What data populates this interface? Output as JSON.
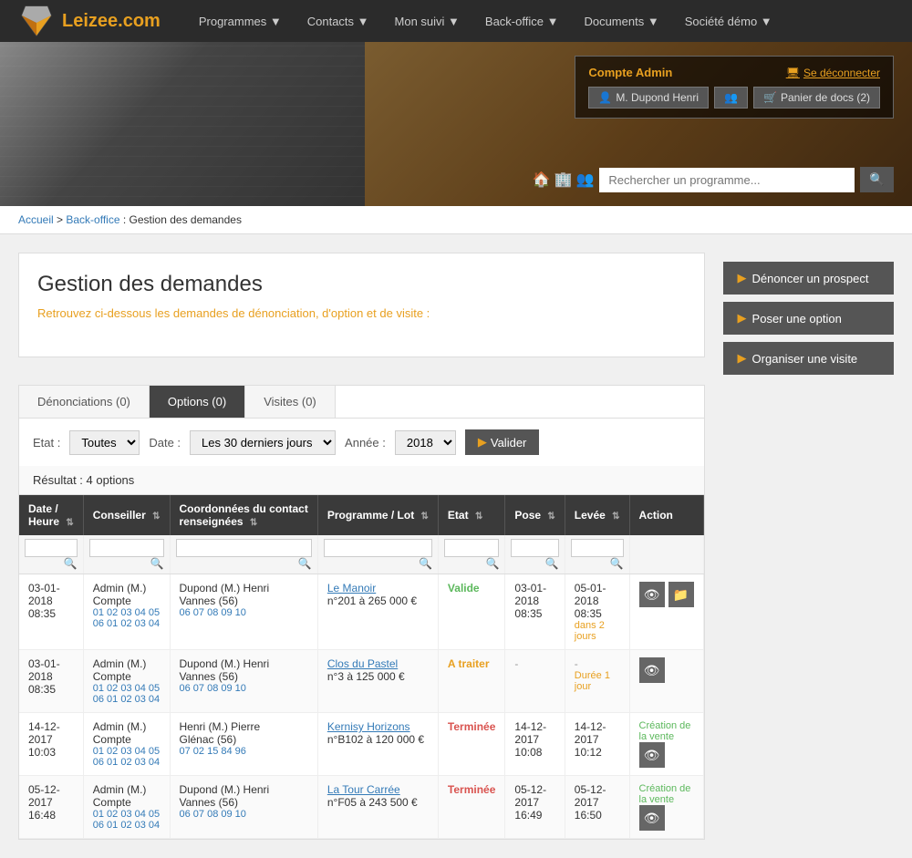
{
  "nav": {
    "logo_text": "Leizee",
    "logo_dot": ".",
    "logo_com": "com",
    "items": [
      {
        "label": "Programmes ▼"
      },
      {
        "label": "Contacts ▼"
      },
      {
        "label": "Mon suivi ▼"
      },
      {
        "label": "Back-office ▼"
      },
      {
        "label": "Documents ▼"
      },
      {
        "label": "Société démo ▼"
      }
    ]
  },
  "account": {
    "title": "Compte Admin",
    "deconnect": "Se déconnecter",
    "user_btn": "M. Dupond Henri",
    "contacts_btn": "",
    "panier_btn": "Panier de docs (2)"
  },
  "search": {
    "placeholder": "Rechercher un programme..."
  },
  "breadcrumb": {
    "home": "Accueil",
    "section": "Back-office",
    "current": "Gestion des demandes"
  },
  "page": {
    "title": "Gestion des demandes",
    "subtitle": "Retrouvez ci-dessous les demandes de dénonciation, d'option et de visite :"
  },
  "actions": {
    "denoncer": "Dénoncer un prospect",
    "option": "Poser une option",
    "visite": "Organiser une visite"
  },
  "tabs": [
    {
      "label": "Dénonciations (0)",
      "active": false
    },
    {
      "label": "Options (0)",
      "active": true
    },
    {
      "label": "Visites (0)",
      "active": false
    }
  ],
  "filters": {
    "etat_label": "Etat :",
    "etat_value": "Toutes",
    "date_label": "Date :",
    "date_value": "Les 30 derniers jours",
    "annee_label": "Année :",
    "annee_value": "2018",
    "valider_label": "Valider"
  },
  "results": {
    "text": "Résultat : 4 options"
  },
  "table": {
    "headers": [
      {
        "label": "Date / Heure"
      },
      {
        "label": "Conseiller"
      },
      {
        "label": "Coordonnées du contact renseignées"
      },
      {
        "label": "Programme / Lot"
      },
      {
        "label": "Etat"
      },
      {
        "label": "Pose"
      },
      {
        "label": "Levée"
      },
      {
        "label": "Action"
      }
    ],
    "rows": [
      {
        "date": "03-01-2018",
        "heure": "08:35",
        "conseiller": "Admin (M.) Compte",
        "conseiller_phones": "01 02 03 04 05\n06 01 02 03 04",
        "contact": "Dupond (M.) Henri",
        "contact_city": "Vannes (56)",
        "contact_phones": "06 07 08 09 10",
        "programme": "Le Manoir",
        "lot": "n°201",
        "prix": "à 265 000 €",
        "etat": "Valide",
        "etat_class": "status-valide",
        "pose": "03-01-2018 08:35",
        "levee": "05-01-2018 08:35",
        "levee_warning": "dans 2 jours",
        "creation": "",
        "actions": [
          "eye",
          "folder"
        ]
      },
      {
        "date": "03-01-2018",
        "heure": "08:35",
        "conseiller": "Admin (M.) Compte",
        "conseiller_phones": "01 02 03 04 05\n06 01 02 03 04",
        "contact": "Dupond (M.) Henri",
        "contact_city": "Vannes (56)",
        "contact_phones": "06 07 08 09 10",
        "programme": "Clos du Pastel",
        "lot": "n°3",
        "prix": "à 125 000 €",
        "etat": "A traiter",
        "etat_class": "status-traiter",
        "pose": "-",
        "levee": "-",
        "levee_warning": "Durée 1 jour",
        "creation": "",
        "actions": [
          "eye"
        ]
      },
      {
        "date": "14-12-2017",
        "heure": "10:03",
        "conseiller": "Admin (M.) Compte",
        "conseiller_phones": "01 02 03 04 05\n06 01 02 03 04",
        "contact": "Henri (M.) Pierre",
        "contact_city": "Glénac (56)",
        "contact_phones": "07 02 15 84 96",
        "programme": "Kernisy Horizons",
        "lot": "n°B102",
        "prix": "à 120 000 €",
        "etat": "Terminée",
        "etat_class": "status-terminee",
        "pose": "14-12-2017 10:08",
        "levee": "14-12-2017 10:12",
        "levee_warning": "",
        "creation": "Création de la vente",
        "actions": [
          "eye"
        ]
      },
      {
        "date": "05-12-2017",
        "heure": "16:48",
        "conseiller": "Admin (M.) Compte",
        "conseiller_phones": "01 02 03 04 05\n06 01 02 03 04",
        "contact": "Dupond (M.) Henri",
        "contact_city": "Vannes (56)",
        "contact_phones": "06 07 08 09 10",
        "programme": "La Tour Carrée",
        "lot": "n°F05",
        "prix": "à 243 500 €",
        "etat": "Terminée",
        "etat_class": "status-terminee",
        "pose": "05-12-2017 16:49",
        "levee": "05-12-2017 16:50",
        "levee_warning": "",
        "creation": "Création de la vente",
        "actions": [
          "eye"
        ]
      }
    ]
  }
}
